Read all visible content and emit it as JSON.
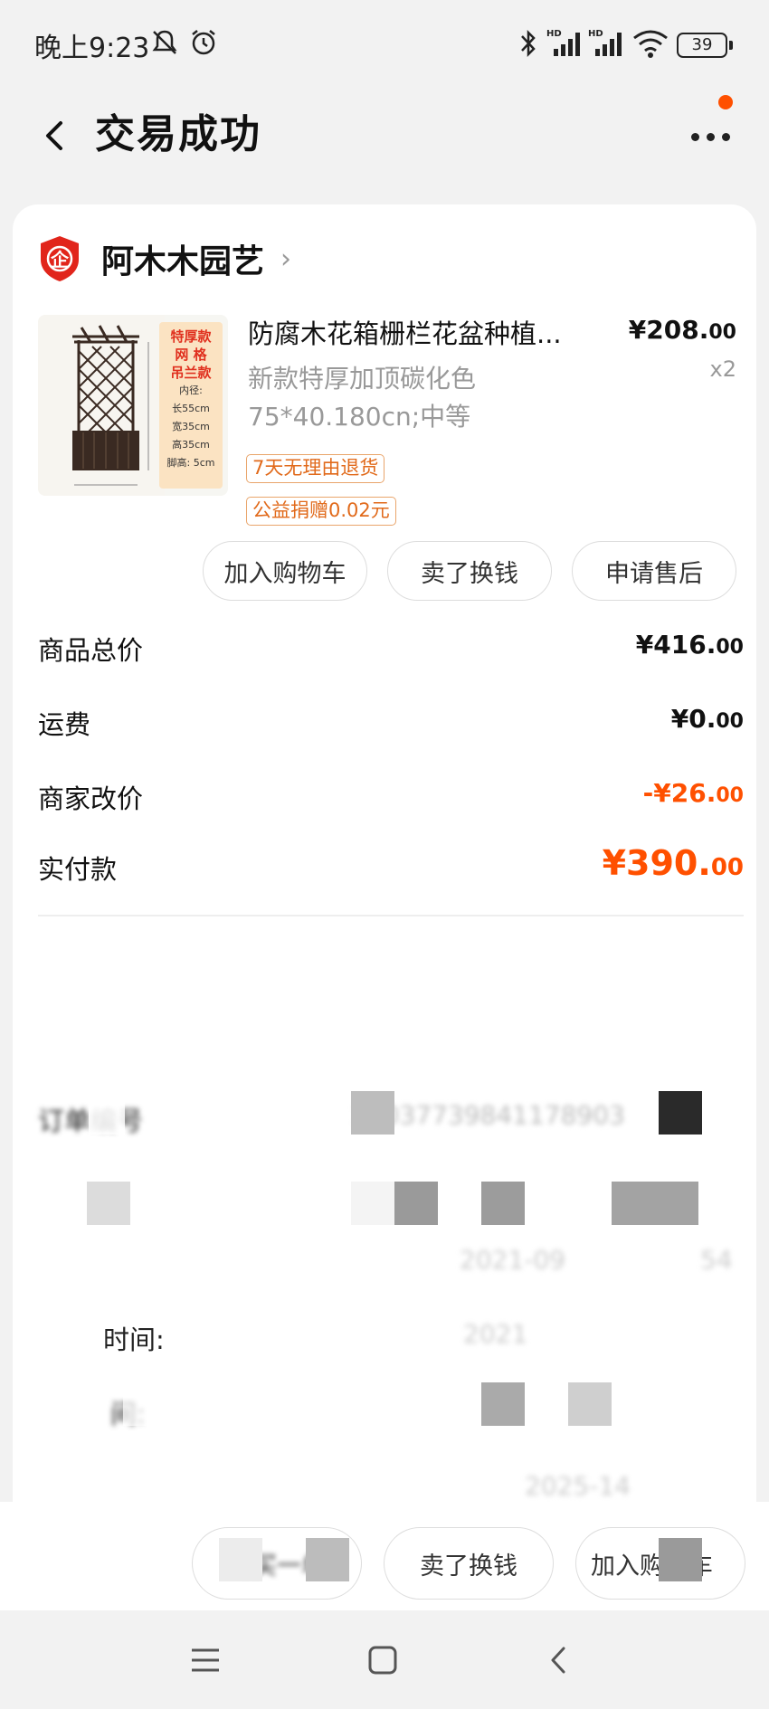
{
  "status_bar": {
    "time": "晚上9:23",
    "battery": "39"
  },
  "header": {
    "title": "交易成功"
  },
  "shop": {
    "name": "阿木木园艺",
    "logo_text": "企"
  },
  "product": {
    "title": "防腐木花箱栅栏花盆种植...",
    "sku_line1": "新款特厚加顶碳化色",
    "sku_line2": "75*40.180cn;中等",
    "price_main": "¥208.",
    "price_dec": "00",
    "quantity": "x2",
    "tags": [
      "7天无理由退货",
      "公益捐赠0.02元"
    ],
    "image_label": {
      "title_lines": [
        "特厚款",
        "网 格",
        "吊兰款"
      ],
      "spec_lines": [
        "内径:",
        "长55cm",
        "宽35cm",
        "高35cm",
        "脚高: 5cm"
      ]
    }
  },
  "item_actions": [
    "加入购物车",
    "卖了换钱",
    "申请售后"
  ],
  "summary": [
    {
      "label": "商品总价",
      "main": "¥416.",
      "dec": "00",
      "style": "normal"
    },
    {
      "label": "运费",
      "main": "¥0.",
      "dec": "00",
      "style": "normal"
    },
    {
      "label": "商家改价",
      "main": "-¥26.",
      "dec": "00",
      "style": "orange"
    },
    {
      "label": "实付款",
      "main": "¥390.",
      "dec": "00",
      "style": "orange-big"
    }
  ],
  "order_info": {
    "order_no_label": "订单编号",
    "order_no_value": "14037739841178903",
    "time_label_2": "时间:",
    "time_value_2": "2021",
    "time_label_3": "间:",
    "time_partial_1": "2021-09",
    "time_partial_1_end": "54",
    "time_partial_4": "2025-14"
  },
  "bottom_actions": {
    "first": "再买一单",
    "second": "卖了换钱",
    "third": "加入购物车"
  },
  "colors": {
    "accent": "#ff5000",
    "tag_border": "#e9a56b",
    "shop_logo": "#e1251b"
  }
}
